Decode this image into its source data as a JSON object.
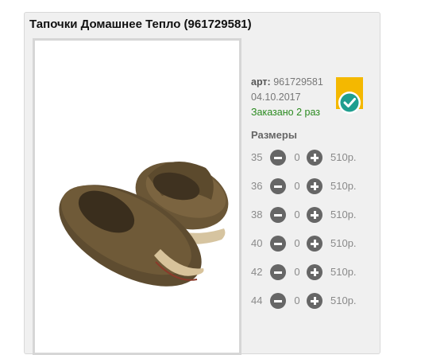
{
  "product": {
    "title": "Тапочки Домашнее Тепло (961729581)",
    "art_label": "арт:",
    "art_value": "961729581",
    "date": "04.10.2017",
    "ordered_text": "Заказано 2 раз",
    "image_icon": "slippers-photo",
    "badge_icon": "check-badge-icon"
  },
  "sizes": {
    "heading": "Размеры",
    "rows": [
      {
        "size": "35",
        "qty": "0",
        "price": "510р."
      },
      {
        "size": "36",
        "qty": "0",
        "price": "510р."
      },
      {
        "size": "38",
        "qty": "0",
        "price": "510р."
      },
      {
        "size": "40",
        "qty": "0",
        "price": "510р."
      },
      {
        "size": "42",
        "qty": "0",
        "price": "510р."
      },
      {
        "size": "44",
        "qty": "0",
        "price": "510р."
      }
    ]
  },
  "colors": {
    "ordered": "#2a8a1f",
    "badge_yellow": "#f4b800",
    "badge_teal": "#1f9e8f"
  }
}
